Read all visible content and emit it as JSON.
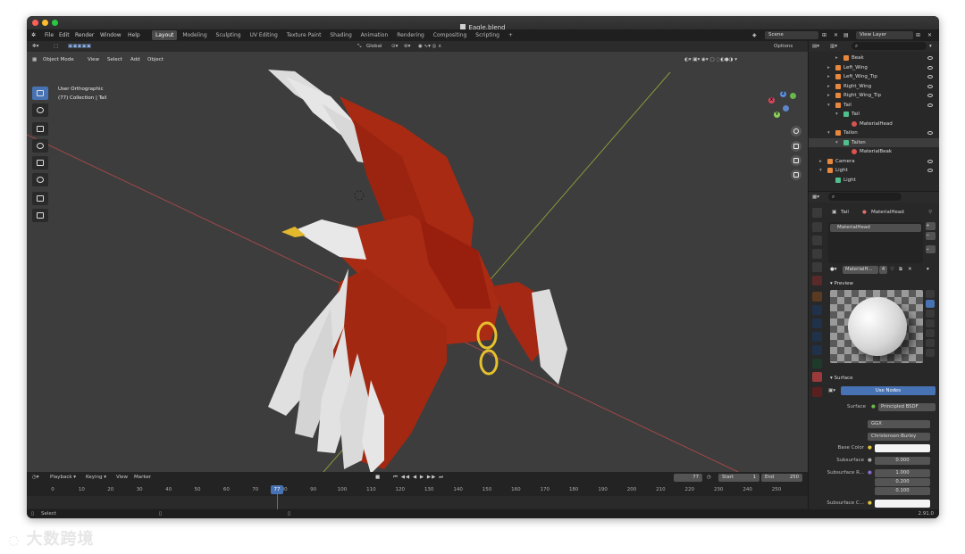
{
  "window": {
    "title": "Eagle.blend",
    "traffic_lights": [
      "#ff5f57",
      "#febc2e",
      "#28c840"
    ]
  },
  "topbar": {
    "menus": [
      "File",
      "Edit",
      "Render",
      "Window",
      "Help"
    ],
    "workspaces": [
      "Layout",
      "Modeling",
      "Sculpting",
      "UV Editing",
      "Texture Paint",
      "Shading",
      "Animation",
      "Rendering",
      "Compositing",
      "Scripting"
    ],
    "active_workspace": "Layout",
    "add_tab": "+",
    "scene": "Scene",
    "view_layer": "View Layer"
  },
  "viewport_header": {
    "transform_orientation": "Global",
    "options": "Options"
  },
  "viewport_menu": {
    "mode": "Object Mode",
    "items": [
      "View",
      "Select",
      "Add",
      "Object"
    ]
  },
  "viewport_overlay": {
    "view_name": "User Orthographic",
    "collection_info": "(77) Collection | Tail"
  },
  "gizmo": {
    "x": "X",
    "y": "Y",
    "z": "Z"
  },
  "outliner": {
    "rows": [
      {
        "label": "Beak",
        "indent": 3,
        "color": "#e8883d"
      },
      {
        "label": "Left_Wing",
        "indent": 2,
        "color": "#e8883d"
      },
      {
        "label": "Left_Wing_Tip",
        "indent": 2,
        "color": "#e8883d"
      },
      {
        "label": "Right_Wing",
        "indent": 2,
        "color": "#e8883d"
      },
      {
        "label": "Right_Wing_Tip",
        "indent": 2,
        "color": "#e8883d"
      },
      {
        "label": "Tail",
        "indent": 2,
        "color": "#e8883d"
      },
      {
        "label": "Tail",
        "indent": 3,
        "color": "#4fc08d"
      },
      {
        "label": "MaterialHead",
        "indent": 4,
        "color": "#d9534f"
      },
      {
        "label": "Tailon",
        "indent": 2,
        "color": "#e8883d"
      },
      {
        "label": "Tailon",
        "indent": 3,
        "color": "#4fc08d"
      },
      {
        "label": "MaterialBeak",
        "indent": 4,
        "color": "#d9534f"
      },
      {
        "label": "Camera",
        "indent": 1,
        "color": "#e8883d"
      },
      {
        "label": "Light",
        "indent": 1,
        "color": "#e8883d"
      },
      {
        "label": "Light",
        "indent": 2,
        "color": "#4fc08d"
      }
    ]
  },
  "properties": {
    "object": "Tail",
    "material": "MaterialHead",
    "slot": "MaterialHead",
    "material_field": "MaterialH...",
    "users": "4",
    "preview_label": "Preview",
    "surface_label": "Surface",
    "use_nodes": "Use Nodes",
    "surface_prop": "Surface",
    "surface_value": "Principled BSDF",
    "distribution": "GGX",
    "subsurface_method": "Christensen-Burley",
    "base_color_label": "Base Color",
    "subsurface_label": "Subsurface",
    "subsurface_value": "0.000",
    "subsurface_radius_label": "Subsurface R...",
    "subsurface_radius": [
      "1.000",
      "0.200",
      "0.100"
    ],
    "subsurface_color_label": "Subsurface C..."
  },
  "timeline": {
    "menus": [
      "Playback",
      "Keying",
      "View",
      "Marker"
    ],
    "current_frame": "77",
    "start_label": "Start",
    "start": "1",
    "end_label": "End",
    "end": "250",
    "ticks": [
      "0",
      "10",
      "20",
      "30",
      "40",
      "50",
      "60",
      "70",
      "80",
      "90",
      "100",
      "110",
      "120",
      "130",
      "140",
      "150",
      "160",
      "170",
      "180",
      "190",
      "200",
      "210",
      "220",
      "230",
      "240",
      "250"
    ]
  },
  "status": {
    "left": "Select",
    "version": "2.91.0"
  },
  "watermark": "大数跨境"
}
